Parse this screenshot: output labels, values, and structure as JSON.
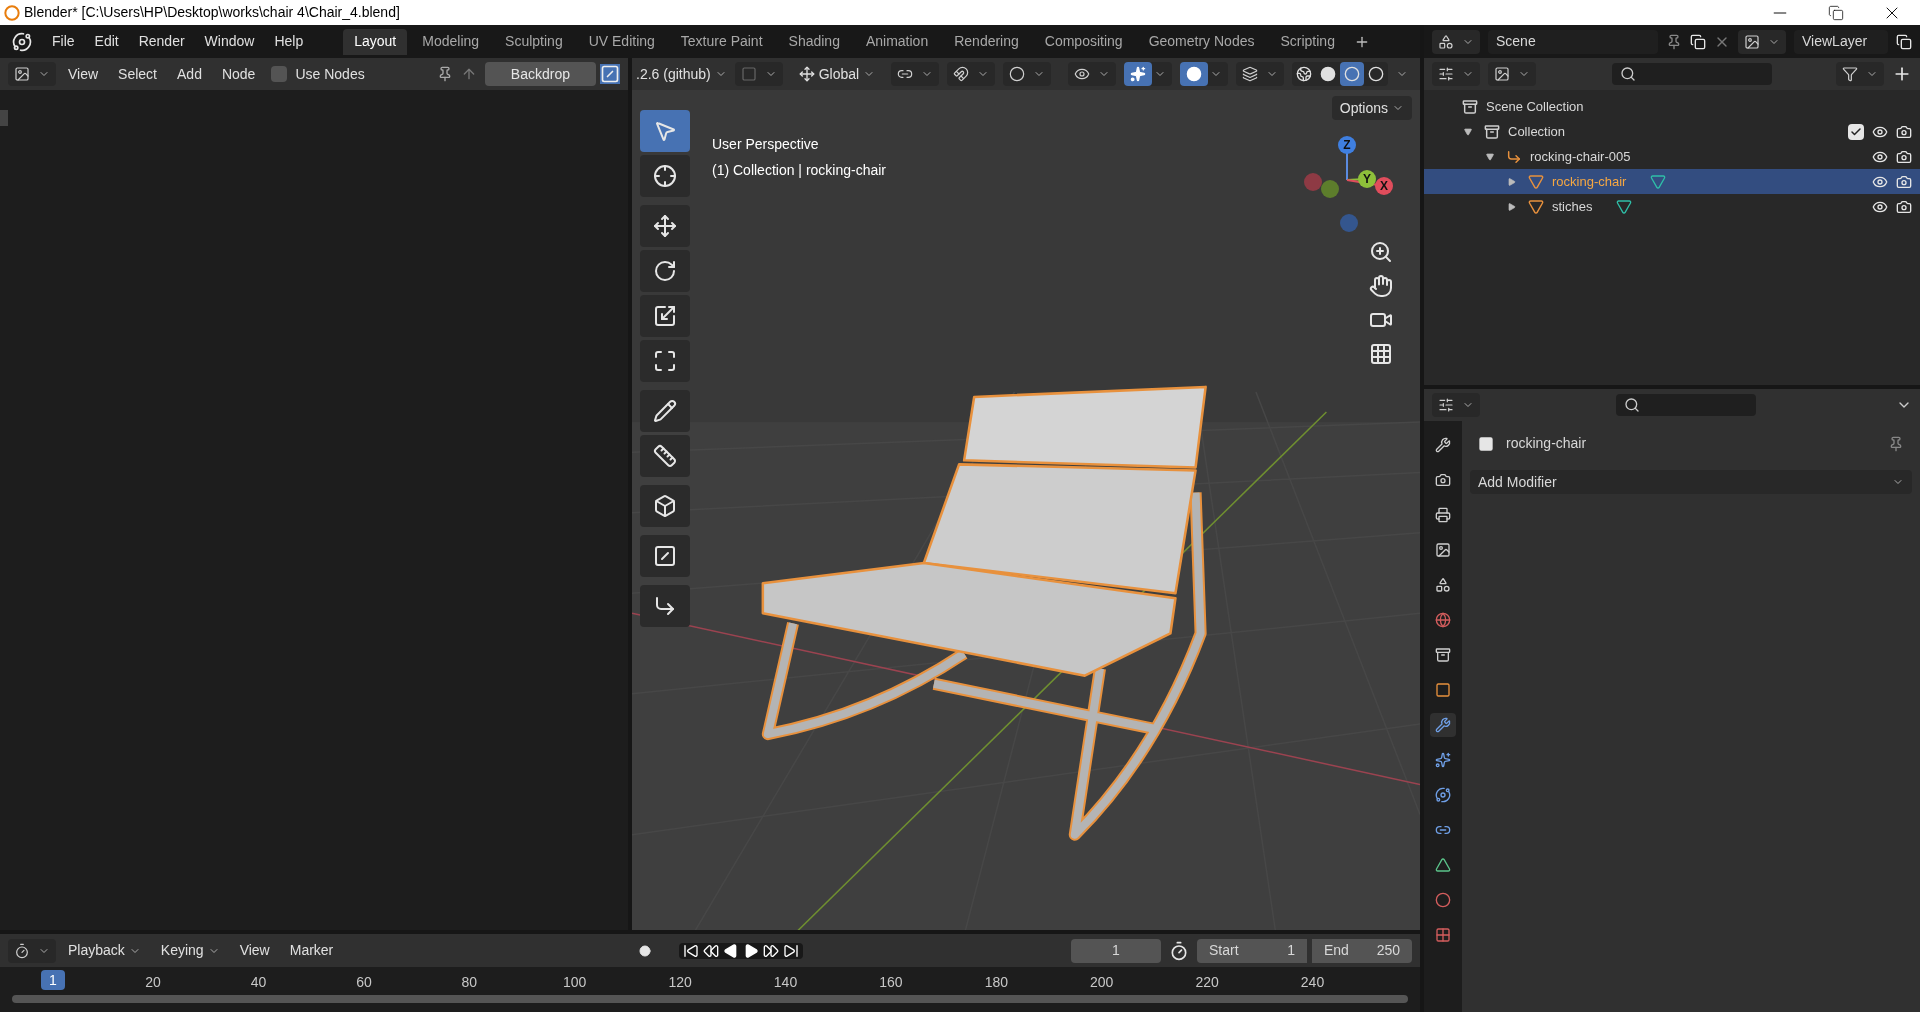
{
  "window": {
    "title": "Blender* [C:\\Users\\HP\\Desktop\\works\\chair 4\\Chair_4.blend]"
  },
  "menu": [
    "File",
    "Edit",
    "Render",
    "Window",
    "Help"
  ],
  "workspace_tabs": [
    {
      "label": "Layout",
      "selected": true
    },
    {
      "label": "Modeling",
      "selected": false
    },
    {
      "label": "Sculpting",
      "selected": false
    },
    {
      "label": "UV Editing",
      "selected": false
    },
    {
      "label": "Texture Paint",
      "selected": false
    },
    {
      "label": "Shading",
      "selected": false
    },
    {
      "label": "Animation",
      "selected": false
    },
    {
      "label": "Rendering",
      "selected": false
    },
    {
      "label": "Compositing",
      "selected": false
    },
    {
      "label": "Geometry Nodes",
      "selected": false
    },
    {
      "label": "Scripting",
      "selected": false
    }
  ],
  "node_editor": {
    "menus": [
      "View",
      "Select",
      "Add",
      "Node"
    ],
    "use_nodes": {
      "label": "Use Nodes",
      "checked": false
    },
    "backdrop": "Backdrop"
  },
  "viewport": {
    "version_field": ".2.6 (github)",
    "orientation": "Global",
    "options": "Options",
    "info_lines": [
      "User Perspective",
      "(1) Collection | rocking-chair"
    ],
    "gizmo_axes": [
      "Z",
      "Y",
      "X"
    ],
    "tools": [
      {
        "kind": "select",
        "selected": true
      },
      {
        "kind": "cursor",
        "selected": false
      },
      {
        "kind": "move",
        "selected": false
      },
      {
        "kind": "rotate",
        "selected": false
      },
      {
        "kind": "scale",
        "selected": false
      },
      {
        "kind": "transform",
        "selected": false
      },
      {
        "kind": "annotate",
        "selected": false
      },
      {
        "kind": "measure",
        "selected": false
      },
      {
        "kind": "add-cube",
        "selected": false
      },
      {
        "kind": "inset",
        "selected": false
      },
      {
        "kind": "bevel",
        "selected": false
      }
    ],
    "toggles": [
      {
        "kind": "gizmo",
        "on": true
      },
      {
        "kind": "overlay",
        "on": true
      },
      {
        "kind": "xray",
        "on": false
      }
    ],
    "shading_modes": [
      {
        "kind": "wireframe",
        "selected": false
      },
      {
        "kind": "solid",
        "selected": false
      },
      {
        "kind": "material",
        "selected": true
      },
      {
        "kind": "rendered",
        "selected": false
      }
    ]
  },
  "timeline": {
    "menus": [
      "Playback",
      "Keying",
      "View",
      "Marker"
    ],
    "current_frame": "1",
    "start_label": "Start",
    "start": "1",
    "end_label": "End",
    "end": "250",
    "playhead": "1",
    "ruler": [
      "20",
      "40",
      "60",
      "80",
      "100",
      "120",
      "140",
      "160",
      "180",
      "200",
      "220",
      "240"
    ]
  },
  "outliner": {
    "scene": "Scene",
    "view_layer": "ViewLayer",
    "tree": [
      {
        "label": "Scene Collection",
        "kind": "scene",
        "selected": false,
        "children": [
          {
            "label": "Collection",
            "kind": "collection",
            "selected": false,
            "expanded": true,
            "checked": true,
            "children": [
              {
                "label": "rocking-chair-005",
                "kind": "empty",
                "selected": false,
                "expanded": true,
                "children": [
                  {
                    "label": "rocking-chair",
                    "kind": "mesh",
                    "selected": true,
                    "expanded": false
                  },
                  {
                    "label": "stiches",
                    "kind": "mesh",
                    "selected": false,
                    "expanded": false
                  }
                ]
              }
            ]
          }
        ]
      }
    ]
  },
  "properties": {
    "object": "rocking-chair",
    "add_modifier": "Add Modifier",
    "tabs": [
      {
        "kind": "tool",
        "selected": false
      },
      {
        "kind": "render",
        "selected": false
      },
      {
        "kind": "output",
        "selected": false
      },
      {
        "kind": "view-layer",
        "selected": false
      },
      {
        "kind": "scene",
        "selected": false
      },
      {
        "kind": "world",
        "selected": false
      },
      {
        "kind": "collection",
        "selected": false
      },
      {
        "kind": "object",
        "selected": false
      },
      {
        "kind": "modifier",
        "selected": true
      },
      {
        "kind": "particles",
        "selected": false
      },
      {
        "kind": "physics",
        "selected": false
      },
      {
        "kind": "constraints",
        "selected": false
      },
      {
        "kind": "data",
        "selected": false
      },
      {
        "kind": "material",
        "selected": false
      },
      {
        "kind": "texture",
        "selected": false
      }
    ]
  }
}
